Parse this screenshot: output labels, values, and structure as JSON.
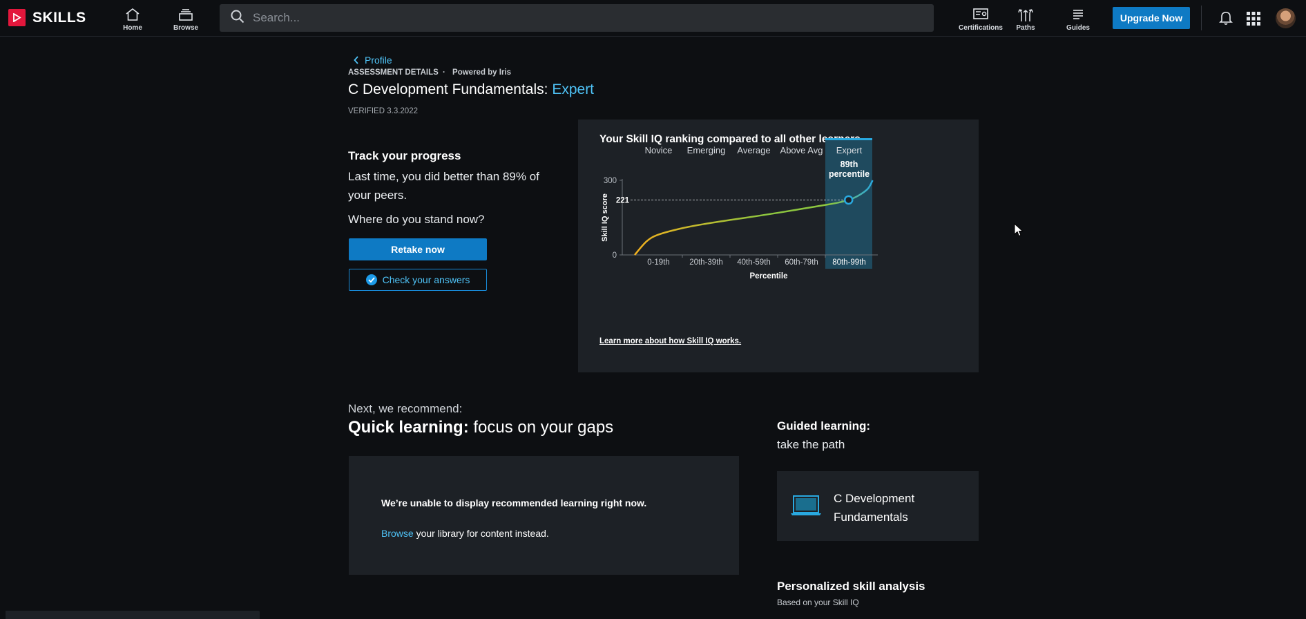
{
  "app": {
    "logo_text": "SKILLS",
    "nav": {
      "home": "Home",
      "browse": "Browse",
      "certifications": "Certifications",
      "paths": "Paths",
      "guides": "Guides"
    },
    "search_placeholder": "Search...",
    "upgrade_label": "Upgrade Now",
    "accent_color": "#0e7ac4",
    "brand_color": "#e3173c"
  },
  "header": {
    "breadcrumb": "Profile",
    "assessment_label": "ASSESSMENT DETAILS",
    "separator": "·",
    "powered_by": "Powered by Iris",
    "title_prefix": "C Development Fundamentals:",
    "title_level": "Expert",
    "verified": "VERIFIED 3.3.2022"
  },
  "progress": {
    "heading": "Track your progress",
    "text": "Last time, you did better than 89% of your peers.",
    "question": "Where do you stand now?",
    "retake_label": "Retake now",
    "check_label": "Check your answers"
  },
  "chart_data": {
    "type": "line",
    "title": "Your Skill IQ ranking compared to all other learners",
    "xlabel": "Percentile",
    "ylabel": "Skill IQ score",
    "ylim": [
      0,
      300
    ],
    "y_ticks": [
      0,
      300
    ],
    "categories": [
      "0-19th",
      "20th-39th",
      "40th-59th",
      "60th-79th",
      "80th-99th"
    ],
    "levels": [
      "Novice",
      "Emerging",
      "Average",
      "Above Avg",
      "Expert"
    ],
    "highlighted_level": "Expert",
    "score": 221,
    "score_percentile_line1": "89th",
    "score_percentile_line2": "percentile",
    "curve_percentile": [
      0,
      5,
      10,
      20,
      30,
      40,
      50,
      60,
      70,
      80,
      85,
      89,
      93,
      97,
      99
    ],
    "curve_score": [
      0,
      55,
      82,
      108,
      126,
      141,
      155,
      170,
      186,
      202,
      211,
      221,
      238,
      266,
      300
    ],
    "colors": {
      "curve_start": "#f2b01e",
      "curve_mid": "#8dc63f",
      "curve_end": "#29a9e0",
      "highlight_band": "#1f4a5e"
    }
  },
  "chart_link": "Learn more about how Skill IQ works.",
  "recommend": {
    "intro": "Next, we recommend:",
    "quick_bold": "Quick learning:",
    "quick_rest": " focus on your gaps",
    "unavailable": "We’re unable to display recommended learning right now.",
    "browse_link": "Browse",
    "browse_rest": " your library for content instead."
  },
  "guided": {
    "heading": "Guided learning:",
    "sub": "take the path",
    "path_name": "C Development Fundamentals"
  },
  "analysis": {
    "heading": "Personalized skill analysis",
    "sub": "Based on your Skill IQ"
  }
}
